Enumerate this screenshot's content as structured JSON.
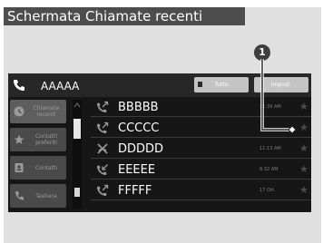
{
  "title": "Schermata Chiamate recenti",
  "header": {
    "contact_name": "AAAAA",
    "all_button_label": "Tutto",
    "settings_button_label": "Impost."
  },
  "sidebar": {
    "items": [
      {
        "label": "Chiamate recenti",
        "icon": "clock-icon"
      },
      {
        "label": "Contatti preferiti",
        "icon": "star-icon"
      },
      {
        "label": "Contatti",
        "icon": "contacts-icon"
      },
      {
        "label": "Tastiera",
        "icon": "keypad-icon"
      }
    ]
  },
  "calls": [
    {
      "name": "BBBBB",
      "time": "11:39 AM",
      "type": "outgoing"
    },
    {
      "name": "CCCCC",
      "time": "",
      "type": "outgoing"
    },
    {
      "name": "DDDDD",
      "time": "11:13 AM",
      "type": "missed"
    },
    {
      "name": "EEEEE",
      "time": "8:32 AM",
      "type": "incoming"
    },
    {
      "name": "FFFFF",
      "time": "17 Ott.",
      "type": "outgoing"
    }
  ],
  "callout": {
    "number": "1"
  },
  "colors": {
    "title_bg": "#4d4d4d",
    "frame_bg": "#e0e0e0",
    "screen_bg": "#161616",
    "sidebar_item": "#4a4a4a",
    "button": "#c4c4c4",
    "text_dim": "#7b7b7b"
  }
}
